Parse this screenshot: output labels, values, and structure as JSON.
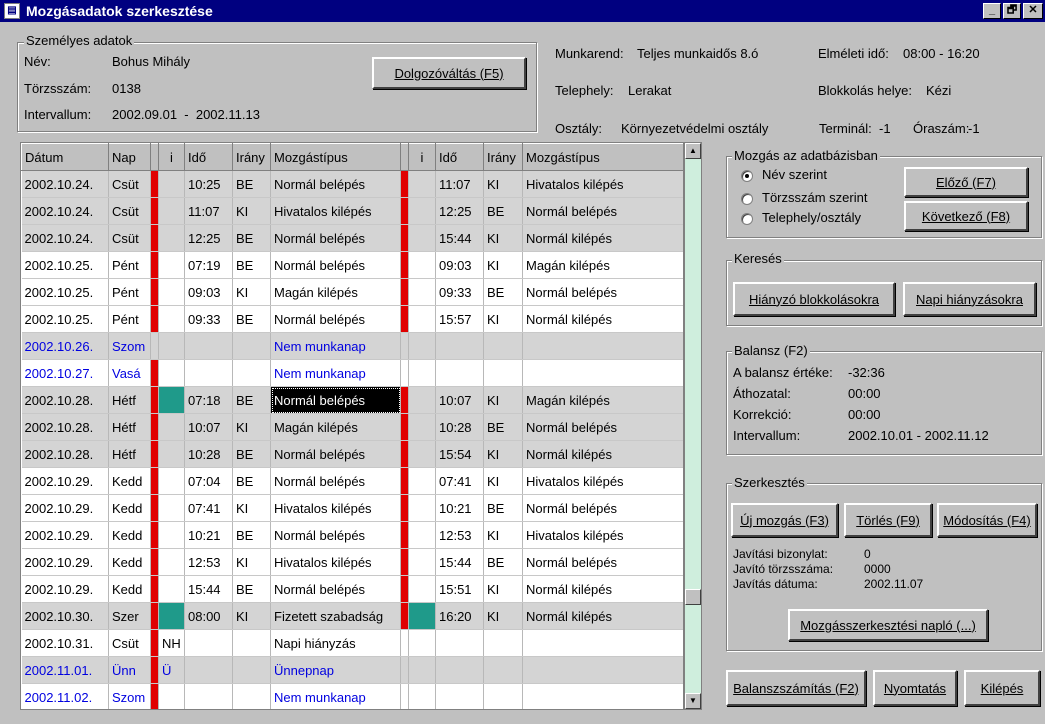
{
  "window": {
    "title": "Mozgásadatok szerkesztése",
    "min_glyph": "_",
    "max_glyph": "🗗",
    "close_glyph": "✕"
  },
  "personal": {
    "group_label": "Személyes adatok",
    "name_label": "Név:",
    "name_value": "Bohus Mihály",
    "id_label": "Törzsszám:",
    "id_value": "0138",
    "interval_label": "Intervallum:",
    "interval_value": "2002.09.01  -  2002.11.13",
    "switch_button": "Dolgozóváltás (F5)"
  },
  "info": {
    "schedule_label": "Munkarend:",
    "schedule_value": "Teljes munkaidős 8.ó",
    "site_label": "Telephely:",
    "site_value": "Lerakat",
    "dept_label": "Osztály:",
    "dept_value": "Környezetvédelmi osztály",
    "theory_label": "Elméleti idő:",
    "theory_value": "08:00 - 16:20",
    "clock_label": "Blokkolás helye:",
    "clock_value": "Kézi",
    "terminal_label": "Terminál:",
    "terminal_value": "-1",
    "hours_label": "Óraszám:",
    "hours_value": "-1"
  },
  "grid": {
    "headers": [
      "Dátum",
      "Nap",
      "",
      "i",
      "Idő",
      "Irány",
      "Mozgástípus",
      "",
      "i",
      "Idő",
      "Irány",
      "Mozgástípus"
    ],
    "rows": [
      {
        "date": "2002.10.24.",
        "day": "Csüt",
        "i1": "",
        "t1": "10:25",
        "d1": "BE",
        "m1": "Normál belépés",
        "i2": "",
        "t2": "11:07",
        "d2": "KI",
        "m2": "Hivatalos kilépés",
        "shade": "g",
        "blue": false,
        "red1": true,
        "red2": true
      },
      {
        "date": "2002.10.24.",
        "day": "Csüt",
        "i1": "",
        "t1": "11:07",
        "d1": "KI",
        "m1": "Hivatalos kilépés",
        "i2": "",
        "t2": "12:25",
        "d2": "BE",
        "m2": "Normál belépés",
        "shade": "g",
        "blue": false,
        "red1": true,
        "red2": true
      },
      {
        "date": "2002.10.24.",
        "day": "Csüt",
        "i1": "",
        "t1": "12:25",
        "d1": "BE",
        "m1": "Normál belépés",
        "i2": "",
        "t2": "15:44",
        "d2": "KI",
        "m2": "Normál kilépés",
        "shade": "g",
        "blue": false,
        "red1": true,
        "red2": true
      },
      {
        "date": "2002.10.25.",
        "day": "Pént",
        "i1": "",
        "t1": "07:19",
        "d1": "BE",
        "m1": "Normál belépés",
        "i2": "",
        "t2": "09:03",
        "d2": "KI",
        "m2": "Magán kilépés",
        "shade": "w",
        "blue": false,
        "red1": true,
        "red2": true
      },
      {
        "date": "2002.10.25.",
        "day": "Pént",
        "i1": "",
        "t1": "09:03",
        "d1": "KI",
        "m1": "Magán kilépés",
        "i2": "",
        "t2": "09:33",
        "d2": "BE",
        "m2": "Normál belépés",
        "shade": "w",
        "blue": false,
        "red1": true,
        "red2": true
      },
      {
        "date": "2002.10.25.",
        "day": "Pént",
        "i1": "",
        "t1": "09:33",
        "d1": "BE",
        "m1": "Normál belépés",
        "i2": "",
        "t2": "15:57",
        "d2": "KI",
        "m2": "Normál kilépés",
        "shade": "w",
        "blue": false,
        "red1": true,
        "red2": true
      },
      {
        "date": "2002.10.26.",
        "day": "Szom",
        "i1": "",
        "t1": "",
        "d1": "",
        "m1": "Nem munkanap",
        "i2": "",
        "t2": "",
        "d2": "",
        "m2": "",
        "shade": "g",
        "blue": true,
        "red1": false,
        "red2": false
      },
      {
        "date": "2002.10.27.",
        "day": "Vasá",
        "i1": "",
        "t1": "",
        "d1": "",
        "m1": "Nem munkanap",
        "i2": "",
        "t2": "",
        "d2": "",
        "m2": "",
        "shade": "w",
        "blue": true,
        "red1": true,
        "red2": false
      },
      {
        "date": "2002.10.28.",
        "day": "Hétf",
        "i1": "teal",
        "t1": "07:18",
        "d1": "BE",
        "m1": "Normál belépés",
        "i2": "",
        "t2": "10:07",
        "d2": "KI",
        "m2": "Magán kilépés",
        "shade": "g",
        "blue": false,
        "red1": true,
        "red2": true,
        "selected": true
      },
      {
        "date": "2002.10.28.",
        "day": "Hétf",
        "i1": "",
        "t1": "10:07",
        "d1": "KI",
        "m1": "Magán kilépés",
        "i2": "",
        "t2": "10:28",
        "d2": "BE",
        "m2": "Normál belépés",
        "shade": "g",
        "blue": false,
        "red1": true,
        "red2": true
      },
      {
        "date": "2002.10.28.",
        "day": "Hétf",
        "i1": "",
        "t1": "10:28",
        "d1": "BE",
        "m1": "Normál belépés",
        "i2": "",
        "t2": "15:54",
        "d2": "KI",
        "m2": "Normál kilépés",
        "shade": "g",
        "blue": false,
        "red1": true,
        "red2": true
      },
      {
        "date": "2002.10.29.",
        "day": "Kedd",
        "i1": "",
        "t1": "07:04",
        "d1": "BE",
        "m1": "Normál belépés",
        "i2": "",
        "t2": "07:41",
        "d2": "KI",
        "m2": "Hivatalos kilépés",
        "shade": "w",
        "blue": false,
        "red1": true,
        "red2": true
      },
      {
        "date": "2002.10.29.",
        "day": "Kedd",
        "i1": "",
        "t1": "07:41",
        "d1": "KI",
        "m1": "Hivatalos kilépés",
        "i2": "",
        "t2": "10:21",
        "d2": "BE",
        "m2": "Normál belépés",
        "shade": "w",
        "blue": false,
        "red1": true,
        "red2": true
      },
      {
        "date": "2002.10.29.",
        "day": "Kedd",
        "i1": "",
        "t1": "10:21",
        "d1": "BE",
        "m1": "Normál belépés",
        "i2": "",
        "t2": "12:53",
        "d2": "KI",
        "m2": "Hivatalos kilépés",
        "shade": "w",
        "blue": false,
        "red1": true,
        "red2": true
      },
      {
        "date": "2002.10.29.",
        "day": "Kedd",
        "i1": "",
        "t1": "12:53",
        "d1": "KI",
        "m1": "Hivatalos kilépés",
        "i2": "",
        "t2": "15:44",
        "d2": "BE",
        "m2": "Normál belépés",
        "shade": "w",
        "blue": false,
        "red1": true,
        "red2": true
      },
      {
        "date": "2002.10.29.",
        "day": "Kedd",
        "i1": "",
        "t1": "15:44",
        "d1": "BE",
        "m1": "Normál belépés",
        "i2": "",
        "t2": "15:51",
        "d2": "KI",
        "m2": "Normál kilépés",
        "shade": "w",
        "blue": false,
        "red1": true,
        "red2": true
      },
      {
        "date": "2002.10.30.",
        "day": "Szer",
        "i1": "teal",
        "t1": "08:00",
        "d1": "KI",
        "m1": "Fizetett szabadság",
        "i2": "teal",
        "t2": "16:20",
        "d2": "KI",
        "m2": "Normál kilépés",
        "shade": "g",
        "blue": false,
        "red1": true,
        "red2": true
      },
      {
        "date": "2002.10.31.",
        "day": "Csüt",
        "i1": "NH",
        "t1": "",
        "d1": "",
        "m1": "Napi hiányzás",
        "i2": "",
        "t2": "",
        "d2": "",
        "m2": "",
        "shade": "w",
        "blue": false,
        "red1": true,
        "red2": false
      },
      {
        "date": "2002.11.01.",
        "day": "Ünn",
        "i1": "Ü",
        "t1": "",
        "d1": "",
        "m1": "Ünnepnap",
        "i2": "",
        "t2": "",
        "d2": "",
        "m2": "",
        "shade": "g",
        "blue": true,
        "red1": true,
        "red2": false
      },
      {
        "date": "2002.11.02.",
        "day": "Szom",
        "i1": "",
        "t1": "",
        "d1": "",
        "m1": "Nem munkanap",
        "i2": "",
        "t2": "",
        "d2": "",
        "m2": "",
        "shade": "w",
        "blue": true,
        "red1": true,
        "red2": false
      }
    ]
  },
  "nav": {
    "group_label": "Mozgás az adatbázisban",
    "radio_name": "Név szerint",
    "radio_id": "Törzsszám szerint",
    "radio_site": "Telephely/osztály",
    "prev_button": "Előző (F7)",
    "next_button": "Következő (F8)"
  },
  "search": {
    "group_label": "Keresés",
    "missing_button": "Hiányzó blokkolásokra",
    "daily_button": "Napi hiányzásokra"
  },
  "balance": {
    "group_label": "Balansz (F2)",
    "value_label": "A balansz értéke:",
    "value": "-32:36",
    "carry_label": "Áthozatal:",
    "carry_value": "00:00",
    "corr_label": "Korrekció:",
    "corr_value": "00:00",
    "interval_label": "Intervallum:",
    "interval_value": "2002.10.01 - 2002.11.12"
  },
  "edit": {
    "group_label": "Szerkesztés",
    "new_button": "Új mozgás (F3)",
    "delete_button": "Törlés (F9)",
    "modify_button": "Módosítás (F4)",
    "doc_label": "Javítási bizonylat:",
    "doc_value": "0",
    "fixer_label": "Javító törzsszáma:",
    "fixer_value": "0000",
    "date_label": "Javítás dátuma:",
    "date_value": "2002.11.07",
    "log_button": "Mozgásszerkesztési napló (...)"
  },
  "footer": {
    "calc_button": "Balanszszámítás (F2)",
    "print_button": "Nyomtatás",
    "exit_button": "Kilépés"
  },
  "colors": {
    "title_bg": "#000080",
    "marker_red": "#e00000",
    "marker_teal": "#1f9a8a",
    "holiday_blue": "#0000e0"
  }
}
